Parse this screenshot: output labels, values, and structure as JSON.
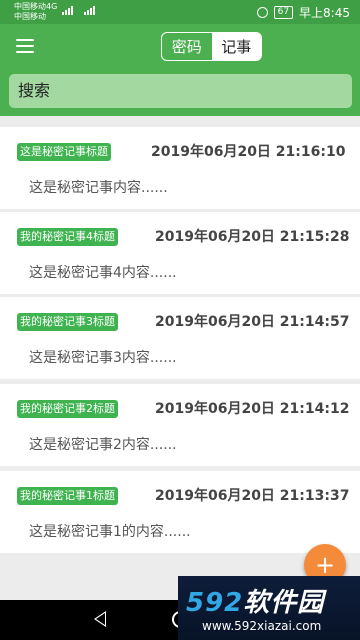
{
  "status_bar": {
    "carrier_line1": "中国移动4G",
    "carrier_line2": "中国移动",
    "battery": "67",
    "time": "早上8:45"
  },
  "header": {
    "tabs": [
      {
        "label": "密码",
        "selected": false
      },
      {
        "label": "记事",
        "selected": true
      }
    ]
  },
  "search": {
    "text": "搜索"
  },
  "notes": [
    {
      "tag": "这是秘密记事标题",
      "date": "2019年06月20日 21:16:10",
      "content": "这是秘密记事内容......"
    },
    {
      "tag": "我的秘密记事4标题",
      "date": "2019年06月20日 21:15:28",
      "content": "这是秘密记事4内容......"
    },
    {
      "tag": "我的秘密记事3标题",
      "date": "2019年06月20日 21:14:57",
      "content": "这是秘密记事3内容......"
    },
    {
      "tag": "我的秘密记事2标题",
      "date": "2019年06月20日 21:14:12",
      "content": "这是秘密记事2内容......"
    },
    {
      "tag": "我的秘密记事1标题",
      "date": "2019年06月20日 21:13:37",
      "content": "这是秘密记事1的内容......"
    }
  ],
  "fab": {
    "label": "+"
  },
  "watermark": {
    "num": "592",
    "name": "软件园",
    "url": "www.592xiazai.com"
  },
  "colors": {
    "status_bar": "#3f9f45",
    "app_bar": "#4caf50",
    "search_box": "#a3d9a0",
    "tag": "#3fb34f",
    "fab": "#f48b3a"
  }
}
